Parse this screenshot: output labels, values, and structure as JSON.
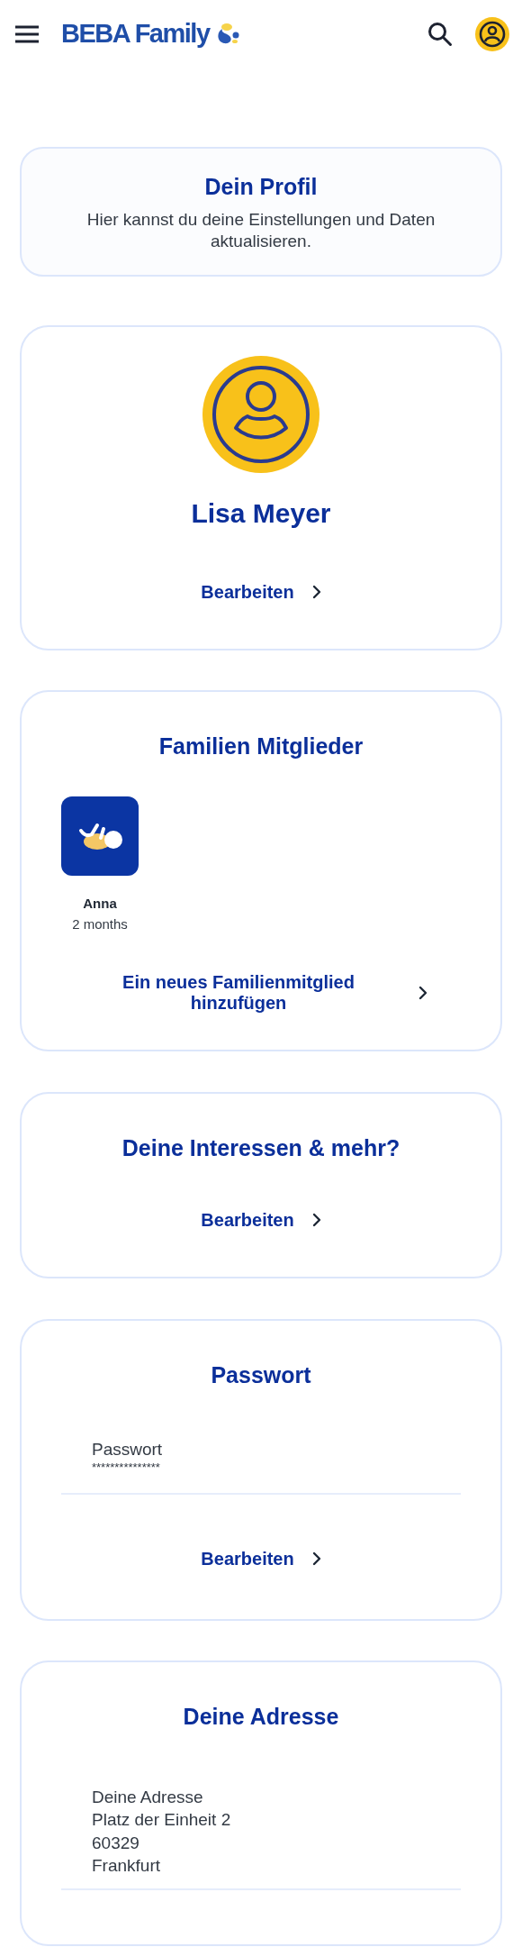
{
  "header": {
    "logo": "BEBA Family"
  },
  "intro": {
    "title": "Dein Profil",
    "text": "Hier kannst du deine Einstellungen und Daten aktualisieren."
  },
  "profile": {
    "name": "Lisa Meyer",
    "action": "Bearbeiten"
  },
  "family": {
    "title": "Familien Mitglieder",
    "members": [
      {
        "name": "Anna",
        "age": "2 months"
      }
    ],
    "action": "Ein neues Familienmitglied hinzufügen"
  },
  "interests": {
    "title": "Deine Interessen & mehr?",
    "action": "Bearbeiten"
  },
  "password": {
    "title": "Passwort",
    "label": "Passwort",
    "value": "***************",
    "action": "Bearbeiten"
  },
  "address": {
    "title": "Deine Adresse",
    "label": "Deine Adresse",
    "lines": [
      "Platz der Einheit 2",
      "60329",
      "Frankfurt"
    ]
  }
}
